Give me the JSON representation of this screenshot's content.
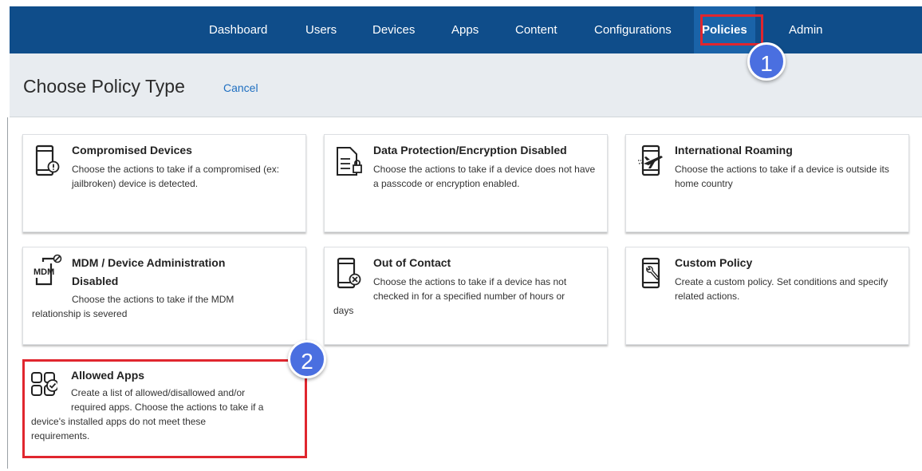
{
  "nav": {
    "items": [
      {
        "label": "Dashboard"
      },
      {
        "label": "Users"
      },
      {
        "label": "Devices"
      },
      {
        "label": "Apps"
      },
      {
        "label": "Content"
      },
      {
        "label": "Configurations"
      },
      {
        "label": "Policies",
        "active": true
      },
      {
        "label": "Admin"
      }
    ]
  },
  "header": {
    "title": "Choose Policy Type",
    "cancel_label": "Cancel"
  },
  "cards": [
    {
      "title": "Compromised Devices",
      "desc": "Choose the actions to take if a compromised (ex: jailbroken) device is detected.",
      "icon": "phone-alert-icon"
    },
    {
      "title": "Data Protection/Encryption Disabled",
      "desc": "Choose the actions to take if a device does not have a passcode or encryption enabled.",
      "icon": "document-lock-icon"
    },
    {
      "title": "International Roaming",
      "desc": "Choose the actions to take if a device is outside its home country",
      "icon": "phone-airplane-icon"
    },
    {
      "title_line1": "MDM / Device Administration",
      "title_line2": "Disabled",
      "desc_line1": "Choose the actions to take if the MDM",
      "desc_line2": "relationship is severed",
      "icon": "mdm-disabled-icon"
    },
    {
      "title": "Out of Contact",
      "desc_line1": "Choose the actions to take if a device has not",
      "desc_line2": "checked in for a specified number of hours or",
      "desc_line3": "days",
      "icon": "phone-blocked-icon"
    },
    {
      "title": "Custom Policy",
      "desc": "Create a custom policy. Set conditions and specify related actions.",
      "icon": "phone-wrench-icon"
    },
    {
      "title": "Allowed Apps",
      "desc_line1": "Create a list of allowed/disallowed and/or",
      "desc_line2": "required apps. Choose the actions to take if a",
      "desc_line3": "device's installed apps do not meet these",
      "desc_line4": "requirements.",
      "icon": "apps-check-icon"
    }
  ],
  "annotations": {
    "step1": "1",
    "step2": "2",
    "highlight_color": "#e0262e",
    "badge_color": "#4a6fe0"
  },
  "colors": {
    "nav_bg": "#0f4d8a",
    "nav_active_bg": "#1a63a8",
    "header_bg": "#e8ecf0",
    "link": "#1f6fc1"
  }
}
